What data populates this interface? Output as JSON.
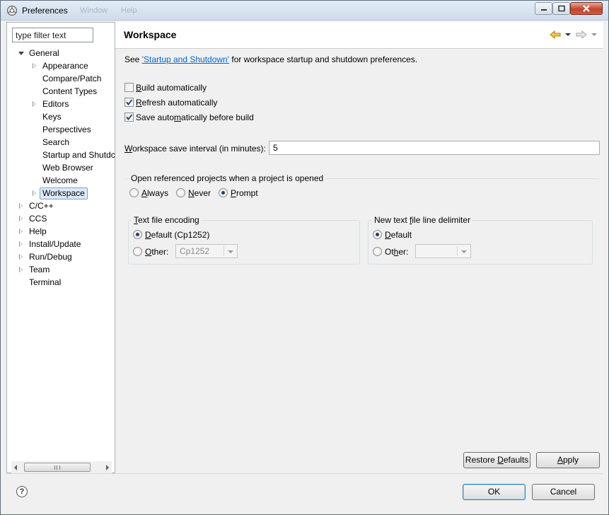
{
  "window": {
    "title": "Preferences",
    "ghost_menu": [
      "Window",
      "Help"
    ]
  },
  "sidebar": {
    "filter_placeholder": "type filter text",
    "items": [
      {
        "label": "General",
        "level": 0,
        "state": "expanded"
      },
      {
        "label": "Appearance",
        "level": 1,
        "state": "collapsed"
      },
      {
        "label": "Compare/Patch",
        "level": 1,
        "state": "leaf"
      },
      {
        "label": "Content Types",
        "level": 1,
        "state": "leaf"
      },
      {
        "label": "Editors",
        "level": 1,
        "state": "collapsed"
      },
      {
        "label": "Keys",
        "level": 1,
        "state": "leaf"
      },
      {
        "label": "Perspectives",
        "level": 1,
        "state": "leaf"
      },
      {
        "label": "Search",
        "level": 1,
        "state": "leaf"
      },
      {
        "label": "Startup and Shutdc",
        "level": 1,
        "state": "leaf"
      },
      {
        "label": "Web Browser",
        "level": 1,
        "state": "leaf"
      },
      {
        "label": "Welcome",
        "level": 1,
        "state": "leaf"
      },
      {
        "label": "Workspace",
        "level": 1,
        "state": "collapsed",
        "selected": true
      },
      {
        "label": "C/C++",
        "level": 0,
        "state": "collapsed"
      },
      {
        "label": "CCS",
        "level": 0,
        "state": "collapsed"
      },
      {
        "label": "Help",
        "level": 0,
        "state": "collapsed"
      },
      {
        "label": "Install/Update",
        "level": 0,
        "state": "collapsed"
      },
      {
        "label": "Run/Debug",
        "level": 0,
        "state": "collapsed"
      },
      {
        "label": "Team",
        "level": 0,
        "state": "collapsed"
      },
      {
        "label": "Terminal",
        "level": 0,
        "state": "leaf"
      }
    ]
  },
  "page": {
    "title": "Workspace",
    "intro_prefix": "See ",
    "intro_link": "'Startup and Shutdown'",
    "intro_suffix": " for workspace startup and shutdown preferences.",
    "checkboxes": [
      {
        "pre": "",
        "mn": "B",
        "post": "uild automatically",
        "checked": false
      },
      {
        "pre": "",
        "mn": "R",
        "post": "efresh automatically",
        "checked": true
      },
      {
        "pre": "Save auto",
        "mn": "m",
        "post": "atically before build",
        "checked": true
      }
    ],
    "save_interval": {
      "pre": "",
      "mn": "W",
      "post": "orkspace save interval (in minutes):",
      "value": "5"
    },
    "open_projects": {
      "title": "Open referenced projects when a project is opened",
      "options": [
        {
          "mn": "A",
          "post": "lways",
          "selected": false
        },
        {
          "mn": "N",
          "post": "ever",
          "selected": false
        },
        {
          "mn": "P",
          "post": "rompt",
          "selected": true
        }
      ]
    },
    "encoding": {
      "title_mn": "T",
      "title_post": "ext file encoding",
      "default_label_mn": "D",
      "default_label_post": "efault (Cp1252)",
      "other_label_mn": "O",
      "other_label_post": "ther:",
      "other_value": "Cp1252",
      "selected": "default"
    },
    "delimiter": {
      "title_pre": "New text ",
      "title_mn": "f",
      "title_post": "ile line delimiter",
      "default_label_mn": "D",
      "default_label_post": "efault",
      "other_label_pre": "Ot",
      "other_label_mn": "h",
      "other_label_post": "er:",
      "other_value": "",
      "selected": "default"
    },
    "buttons": {
      "restore_pre": "Restore ",
      "restore_mn": "D",
      "restore_post": "efaults",
      "apply_mn": "A",
      "apply_post": "pply"
    }
  },
  "footer": {
    "ok": "OK",
    "cancel": "Cancel"
  }
}
